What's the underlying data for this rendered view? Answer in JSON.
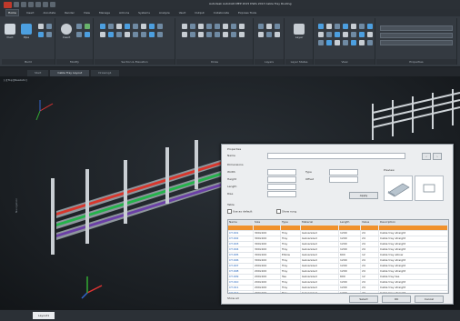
{
  "app": {
    "title": "Autodesk AutoCAD MEP 2015  DWG 2013  Cable Tray Routing"
  },
  "ribbon": {
    "tabs": [
      "Home",
      "Insert",
      "Annotate",
      "Render",
      "View",
      "Manage",
      "Add-ins",
      "Systems",
      "Analyze",
      "Vault",
      "Output",
      "Collaborate",
      "Express Tools"
    ],
    "active_tab": "Home",
    "panels": [
      {
        "label": "Build",
        "buttons": [
          "Duct",
          "Pipe"
        ]
      },
      {
        "label": "Modify",
        "buttons": [
          "Insert"
        ]
      },
      {
        "label": "Section & Elevation",
        "buttons": []
      },
      {
        "label": "Draw",
        "buttons": []
      },
      {
        "label": "Layers",
        "buttons": []
      },
      {
        "label": "Layer States",
        "buttons": [
          "Layer"
        ]
      },
      {
        "label": "View",
        "buttons": []
      },
      {
        "label": "Properties",
        "buttons": []
      }
    ]
  },
  "file_tabs": [
    "Start",
    "Cable Tray Layout",
    "Drawing1"
  ],
  "viewport": {
    "label": "[-][Top][Realistic]",
    "side_text": "Navigation"
  },
  "dialog": {
    "section1": "Properties",
    "name_label": "Name",
    "fields_label": "Dimensions",
    "width_label": "Width",
    "height_label": "Height",
    "length_label": "Length",
    "rise_label": "Rise",
    "type_label": "Type",
    "offset_label": "Offset",
    "apply_label": "Apply",
    "preview_label": "Preview",
    "checkbox1": "Use as default",
    "checkbox2": "Show rung",
    "table_label": "Table",
    "ok_label": "OK",
    "cancel_label": "Cancel",
    "footer_left": "Show all",
    "footer_right": "Select",
    "columns": [
      "Name",
      "Size",
      "Type",
      "Material",
      "Length",
      "Value",
      "Description"
    ],
    "rows": [
      [
        "CT-001",
        "300x100",
        "Tray",
        "Galvanized",
        "1200",
        "24",
        "Cable tray straight"
      ],
      [
        "CT-002",
        "300x100",
        "Tray",
        "Galvanized",
        "1200",
        "24",
        "Cable tray straight"
      ],
      [
        "CT-003",
        "300x100",
        "Tray",
        "Galvanized",
        "1200",
        "24",
        "Cable tray straight"
      ],
      [
        "CT-004",
        "300x100",
        "Tray",
        "Galvanized",
        "1200",
        "24",
        "Cable tray straight"
      ],
      [
        "CT-005",
        "300x100",
        "Elbow",
        "Galvanized",
        "600",
        "12",
        "Cable tray elbow"
      ],
      [
        "CT-006",
        "300x100",
        "Tray",
        "Galvanized",
        "1200",
        "24",
        "Cable tray straight"
      ],
      [
        "CT-007",
        "200x100",
        "Tray",
        "Galvanized",
        "1200",
        "24",
        "Cable tray straight"
      ],
      [
        "CT-008",
        "200x100",
        "Tray",
        "Galvanized",
        "1200",
        "24",
        "Cable tray straight"
      ],
      [
        "CT-009",
        "200x100",
        "Tee",
        "Galvanized",
        "600",
        "12",
        "Cable tray tee"
      ],
      [
        "CT-010",
        "200x100",
        "Tray",
        "Galvanized",
        "1200",
        "24",
        "Cable tray straight"
      ],
      [
        "CT-011",
        "200x100",
        "Tray",
        "Galvanized",
        "1200",
        "24",
        "Cable tray straight"
      ],
      [
        "CT-012",
        "200x100",
        "Tray",
        "Galvanized",
        "1200",
        "24",
        "Cable tray straight"
      ],
      [
        "CT-013",
        "200x100",
        "Reducer",
        "Galvanized",
        "600",
        "12",
        "Cable tray reducer"
      ]
    ]
  },
  "status": {
    "layout_tab": "Layout1"
  },
  "colors": {
    "red_tray": "#d8362c",
    "green_tray": "#24b34b",
    "purple_tray": "#6b3fa6",
    "selection": "#f0912c"
  }
}
